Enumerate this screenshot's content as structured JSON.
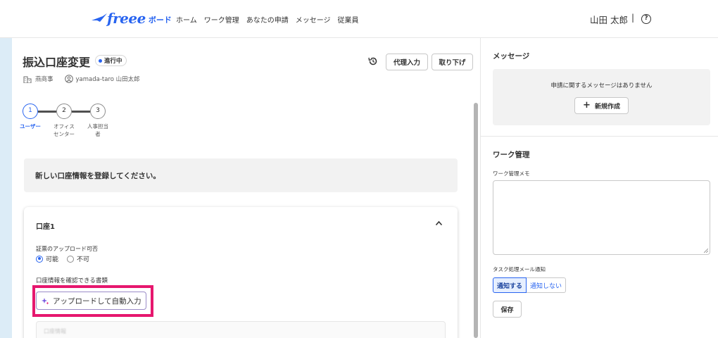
{
  "header": {
    "logo_text": "freee",
    "logo_sub": "ボード",
    "nav": [
      "ホーム",
      "ワーク管理",
      "あなたの申請",
      "メッセージ",
      "従業員"
    ],
    "user_name": "山田 太郎",
    "separator": "|",
    "help_symbol": "?"
  },
  "main": {
    "title": "振込口座変更",
    "status": "進行中",
    "proxy_button": "代理入力",
    "withdraw_button": "取り下げ",
    "company": "燕商事",
    "user": "yamada-taro 山田太郎",
    "steps": [
      {
        "number": "1",
        "label": "ユーザー",
        "active": true
      },
      {
        "number": "2",
        "label": "オフィス センター",
        "active": false
      },
      {
        "number": "3",
        "label": "人事担当 者",
        "active": false
      }
    ],
    "info_message": "新しい口座情報を登録してください。",
    "card": {
      "title": "口座1",
      "upload_permission_label": "証票のアップロード可否",
      "options": [
        "可能",
        "不可"
      ],
      "selected_option": "可能",
      "document_label": "口座情報を確認できる書類",
      "upload_button": "アップロードして自動入力",
      "blurred_field": "口座情報"
    }
  },
  "sidebar": {
    "messages_heading": "メッセージ",
    "no_messages": "申請に関するメッセージはありません",
    "new_button": "新規作成",
    "work_heading": "ワーク管理",
    "memo_label": "ワーク管理メモ",
    "memo_value": "",
    "notify_label": "タスク処理メール通知",
    "notify_on": "通知する",
    "notify_off": "通知しない",
    "notify_selected": "通知する",
    "save_button": "保存"
  },
  "colors": {
    "brand": "#2864f0",
    "highlight": "#e6176e",
    "panel_bg": "#f2f2f2"
  }
}
